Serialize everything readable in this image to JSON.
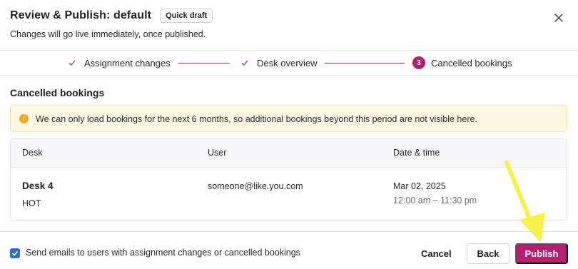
{
  "header": {
    "title": "Review & Publish: default",
    "badge": "Quick draft",
    "subtitle": "Changes will go live immediately, once published."
  },
  "stepper": {
    "steps": [
      {
        "label": "Assignment changes",
        "state": "done"
      },
      {
        "label": "Desk overview",
        "state": "done"
      },
      {
        "label": "Cancelled bookings",
        "state": "current",
        "number": "3"
      }
    ]
  },
  "section": {
    "title": "Cancelled bookings"
  },
  "notice": {
    "icon": "warning-icon",
    "text": "We can only load bookings for the next 6 months, so additional bookings beyond this period are not visible here."
  },
  "table": {
    "headers": [
      "Desk",
      "User",
      "Date & time"
    ],
    "rows": [
      {
        "desk": "Desk 4",
        "desk_type": "HOT",
        "user": "someone@like.you.com",
        "date": "Mar 02, 2025",
        "time": "12:00 am – 11:30 pm"
      }
    ]
  },
  "footer": {
    "checkbox_label": "Send emails to users with assignment changes or cancelled bookings",
    "checkbox_checked": true,
    "cancel_label": "Cancel",
    "back_label": "Back",
    "publish_label": "Publish"
  },
  "colors": {
    "accent": "#b51e6f",
    "checkbox": "#2f6fbf",
    "notice_bg": "#fff9e3",
    "annotation_arrow": "#f7f24a"
  }
}
